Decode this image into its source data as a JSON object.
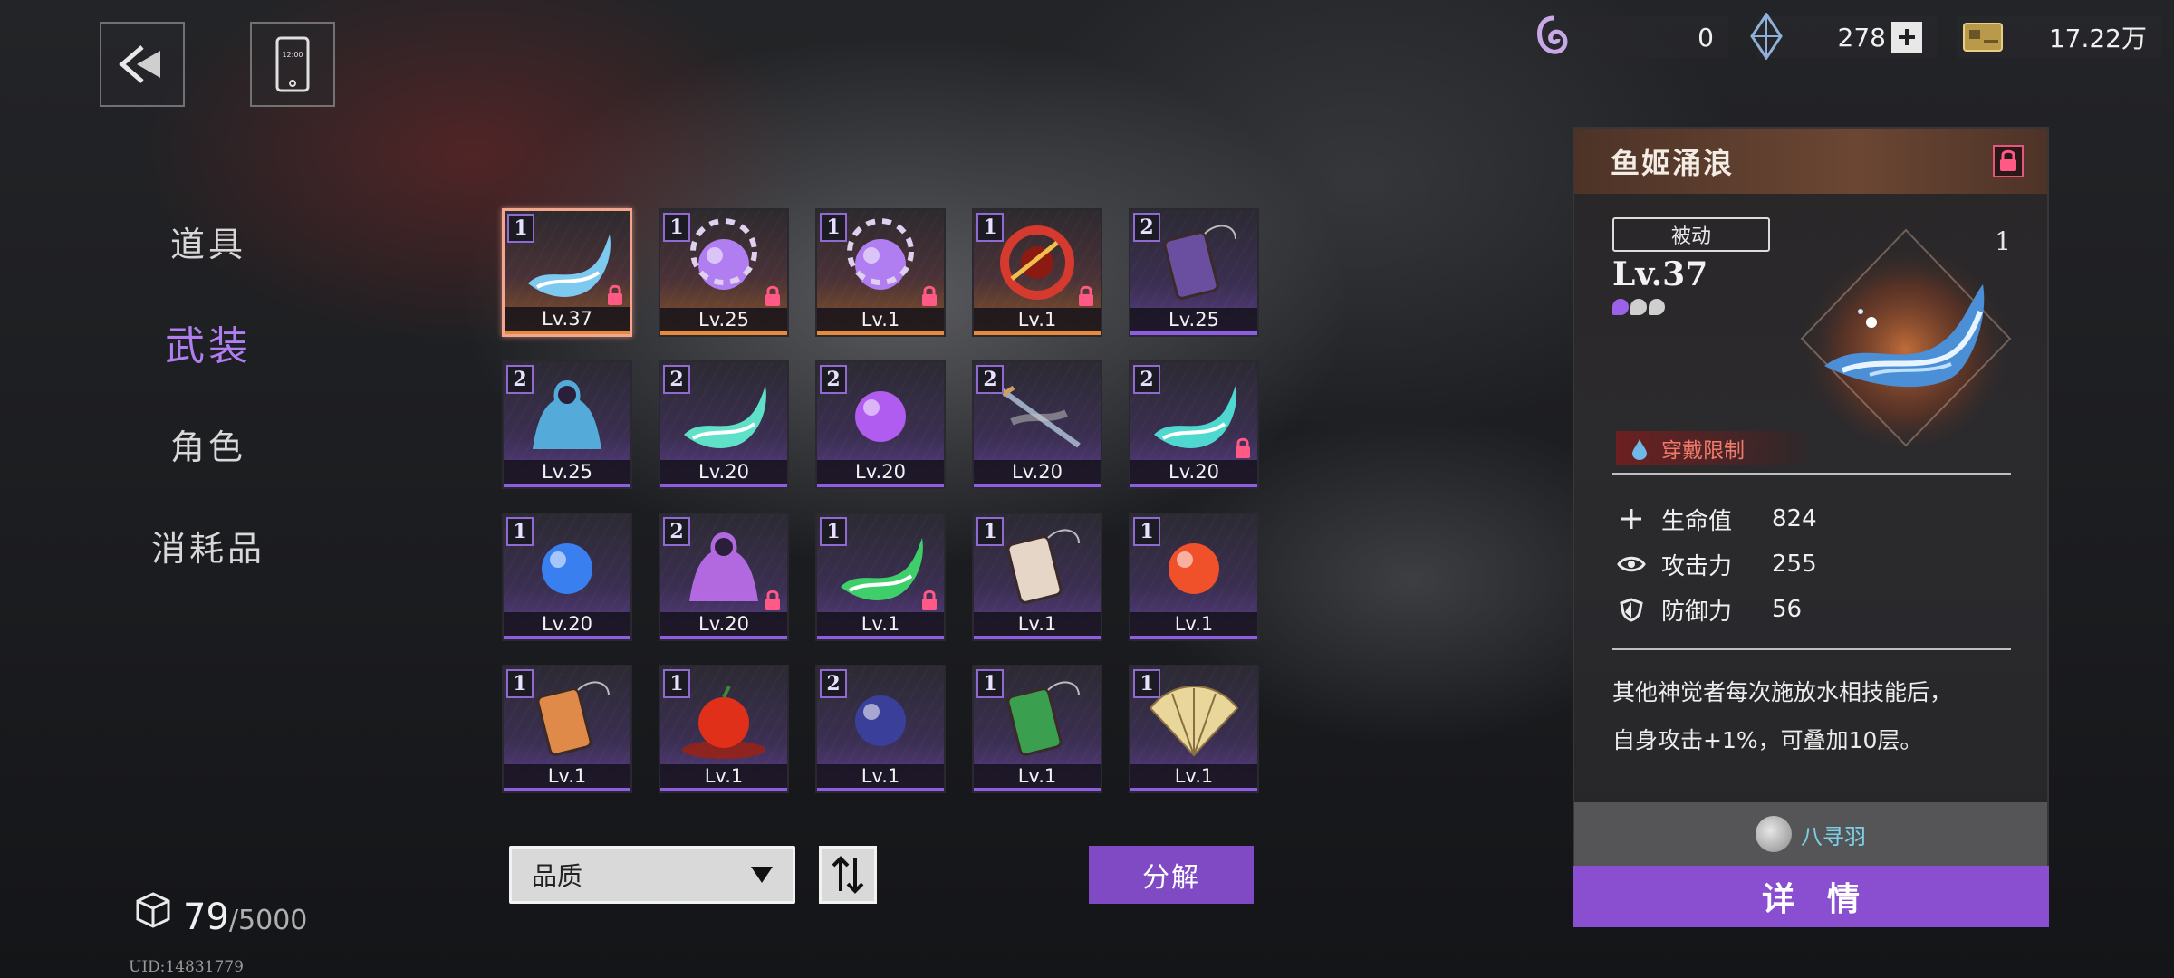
{
  "nav": {
    "items": [
      {
        "label": "道具"
      },
      {
        "label": "武装"
      },
      {
        "label": "角色"
      },
      {
        "label": "消耗品"
      }
    ],
    "active_index": 1
  },
  "inventory": {
    "count": "79",
    "max": "/5000"
  },
  "uid": "UID:14831779",
  "currencies": [
    {
      "icon": "spiral-shell-icon",
      "value": "0"
    },
    {
      "icon": "crystal-icon",
      "value": "278"
    },
    {
      "icon": "coin-card-icon",
      "value": "17.22万"
    }
  ],
  "items": [
    {
      "tier": "1",
      "level": "Lv.37",
      "locked": true,
      "quality": "orange",
      "icon": "water-wave-icon",
      "color": "#7ec9f0",
      "selected": true
    },
    {
      "tier": "1",
      "level": "Lv.25",
      "locked": true,
      "quality": "orange",
      "icon": "purple-orb-skull-icon",
      "color": "#b07ef0"
    },
    {
      "tier": "1",
      "level": "Lv.1",
      "locked": true,
      "quality": "orange",
      "icon": "purple-orb-skull-icon",
      "color": "#b07ef0"
    },
    {
      "tier": "1",
      "level": "Lv.1",
      "locked": true,
      "quality": "orange",
      "icon": "red-dragon-icon",
      "color": "#d63a2e"
    },
    {
      "tier": "2",
      "level": "Lv.25",
      "locked": false,
      "quality": "purple",
      "icon": "dark-tablet-icon",
      "color": "#6a4fa0"
    },
    {
      "tier": "2",
      "level": "Lv.25",
      "locked": false,
      "quality": "purple",
      "icon": "blue-armor-icon",
      "color": "#58b8e8"
    },
    {
      "tier": "2",
      "level": "Lv.20",
      "locked": false,
      "quality": "purple",
      "icon": "teal-wind-icon",
      "color": "#5fe0c8"
    },
    {
      "tier": "2",
      "level": "Lv.20",
      "locked": false,
      "quality": "purple",
      "icon": "violet-orb-icon",
      "color": "#b15cf0"
    },
    {
      "tier": "2",
      "level": "Lv.20",
      "locked": false,
      "quality": "purple",
      "icon": "katana-icon",
      "color": "#9aa8c0"
    },
    {
      "tier": "2",
      "level": "Lv.20",
      "locked": true,
      "quality": "purple",
      "icon": "teal-whale-icon",
      "color": "#4fd8d0"
    },
    {
      "tier": "1",
      "level": "Lv.20",
      "locked": false,
      "quality": "purple",
      "icon": "blue-orb-icon",
      "color": "#3a7ff0"
    },
    {
      "tier": "2",
      "level": "Lv.20",
      "locked": true,
      "quality": "purple",
      "icon": "purple-figure-icon",
      "color": "#c070f0"
    },
    {
      "tier": "1",
      "level": "Lv.1",
      "locked": true,
      "quality": "purple",
      "icon": "green-wind-icon",
      "color": "#3fcf6a"
    },
    {
      "tier": "1",
      "level": "Lv.1",
      "locked": false,
      "quality": "purple",
      "icon": "talisman-tag-icon",
      "color": "#e6d6c8"
    },
    {
      "tier": "1",
      "level": "Lv.1",
      "locked": false,
      "quality": "purple",
      "icon": "red-orb-icon",
      "color": "#f0502a"
    },
    {
      "tier": "1",
      "level": "Lv.1",
      "locked": false,
      "quality": "purple",
      "icon": "omamori-icon",
      "color": "#e08a4a"
    },
    {
      "tier": "1",
      "level": "Lv.1",
      "locked": false,
      "quality": "purple",
      "icon": "red-fruit-icon",
      "color": "#e0301a"
    },
    {
      "tier": "2",
      "level": "Lv.1",
      "locked": false,
      "quality": "purple",
      "icon": "dark-blue-orb-icon",
      "color": "#3a3f9a"
    },
    {
      "tier": "1",
      "level": "Lv.1",
      "locked": false,
      "quality": "purple",
      "icon": "green-tablet-icon",
      "color": "#3aa050"
    },
    {
      "tier": "1",
      "level": "Lv.1",
      "locked": false,
      "quality": "purple",
      "icon": "folding-fan-icon",
      "color": "#e8d69a"
    }
  ],
  "controls": {
    "sort_label": "品质",
    "decompose_label": "分解"
  },
  "detail": {
    "name": "鱼姬涌浪",
    "type_tag": "被动",
    "level": "Lv.37",
    "tier": "1",
    "pips_filled": 1,
    "pips_total": 3,
    "restriction": "穿戴限制",
    "stats": [
      {
        "icon": "plus-icon",
        "name": "生命值",
        "value": "824"
      },
      {
        "icon": "eye-icon",
        "name": "攻击力",
        "value": "255"
      },
      {
        "icon": "shield-icon",
        "name": "防御力",
        "value": "56"
      }
    ],
    "description_line1": "其他神觉者每次施放水相技能后，",
    "description_line2": "自身攻击+1%，可叠加10层。",
    "owner": "八寻羽",
    "detail_button": "详情"
  },
  "colors": {
    "accent_purple": "#8a4fd0",
    "selected_border": "#f4a58e",
    "restriction_red": "#f07a6a",
    "owner_cyan": "#7bd0e6"
  }
}
